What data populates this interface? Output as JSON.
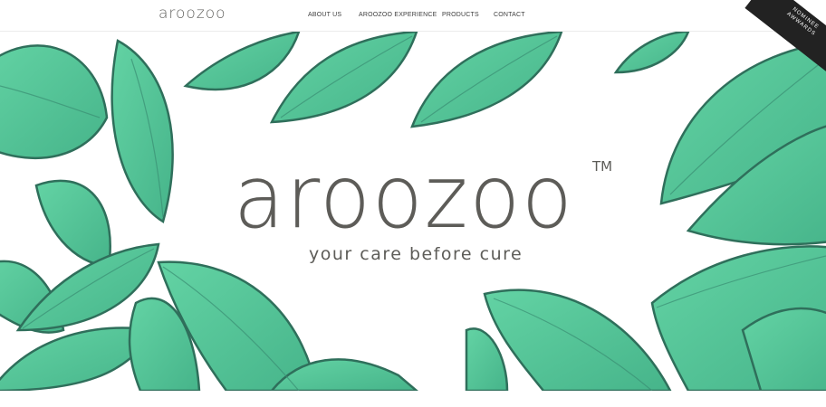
{
  "header": {
    "logo": "aroozoo",
    "nav": [
      {
        "label": "ABOUT US"
      },
      {
        "label": "AROOZOO EXPERIENCE"
      },
      {
        "label": "PRODUCTS"
      },
      {
        "label": "CONTACT"
      }
    ]
  },
  "hero": {
    "title": "aroozoo",
    "trademark": "TM",
    "tagline": "your care before cure"
  },
  "badge": {
    "line1": "NOMINEE",
    "line2": "AWWARDS"
  },
  "colors": {
    "leaf_light": "#5dcb9c",
    "leaf_dark": "#2f6f5b",
    "text": "#5d5c58"
  }
}
